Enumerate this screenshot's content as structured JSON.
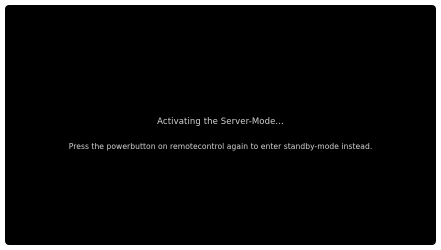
{
  "screen": {
    "background_color": "#000000",
    "text_color": "#cfcfcf",
    "status_message": "Activating the Server-Mode...",
    "instruction_message": "Press the powerbutton on remotecontrol again to enter standby-mode instead."
  }
}
